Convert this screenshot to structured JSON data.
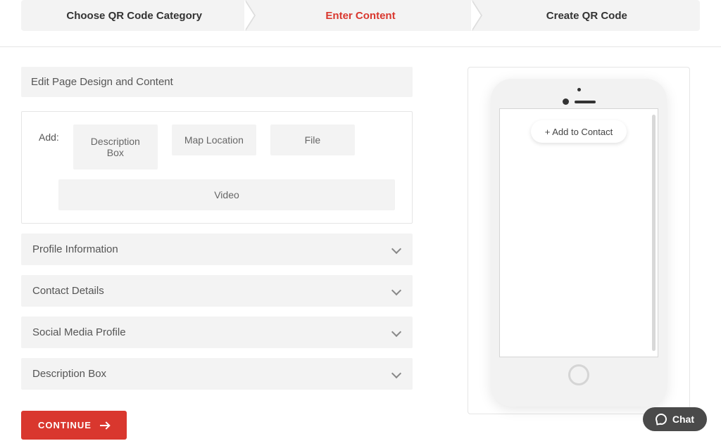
{
  "stepper": {
    "steps": [
      {
        "label": "Choose QR Code Category",
        "active": false
      },
      {
        "label": "Enter Content",
        "active": true
      },
      {
        "label": "Create QR Code",
        "active": false
      }
    ]
  },
  "main": {
    "section_title": "Edit Page Design and Content",
    "add": {
      "label": "Add:",
      "chips": [
        "Description Box",
        "Map Location",
        "File",
        "Video"
      ]
    },
    "accordions": [
      "Profile Information",
      "Contact Details",
      "Social Media Profile",
      "Description Box"
    ],
    "continue_label": "CONTINUE"
  },
  "preview": {
    "add_contact_label": "+ Add to Contact"
  },
  "chat": {
    "label": "Chat"
  }
}
